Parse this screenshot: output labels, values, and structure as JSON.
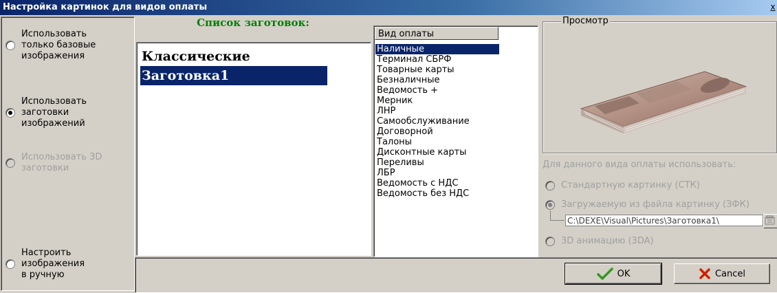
{
  "window": {
    "title": "Настройка картинок для видов оплаты",
    "close_label": "x"
  },
  "left_options": [
    {
      "label": "Использовать только базовые изображения",
      "checked": false,
      "disabled": false
    },
    {
      "label": "Использовать заготовки изображений",
      "checked": true,
      "disabled": false
    },
    {
      "label": "Использовать 3D заготовки",
      "checked": false,
      "disabled": true
    },
    {
      "label": "Настроить изображения в ручную",
      "checked": false,
      "disabled": false
    }
  ],
  "presets": {
    "header": "Список заготовок:",
    "items": [
      "Классические",
      "Заготовка1"
    ],
    "selected_index": 1
  },
  "payment_types": {
    "column_header": "Вид оплаты",
    "items": [
      "Наличные",
      "Терминал СБРФ",
      "Товарные карты",
      "Безналичные",
      "Ведомость +",
      "Мерник",
      "ЛНР",
      "Самообслуживание",
      "Договорной",
      "Талоны",
      "Дисконтные карты",
      "Переливы",
      "ЛБР",
      "Ведомость с НДС",
      "Ведомость без НДС"
    ],
    "selected_index": 0
  },
  "preview": {
    "legend": "Просмотр",
    "image": "banknote-stack-image"
  },
  "use_settings": {
    "caption": "Для данного вида оплаты использовать:",
    "options": [
      {
        "label": "Стандартную картинку (СТК)",
        "checked": false
      },
      {
        "label": "Загружаемую из файла картинку (ЗФК)",
        "checked": true
      },
      {
        "label": "3D анимацию (3DA)",
        "checked": false
      }
    ],
    "file_path": "C:\\DEXE\\Visual\\Pictures\\Заготовка1\\"
  },
  "buttons": {
    "ok": "OK",
    "cancel": "Cancel"
  },
  "colors": {
    "title_bar": "#0a246a",
    "selection": "#0a246a",
    "list_header": "#008000",
    "ok_icon": "#2e9b1c",
    "cancel_icon": "#cc2200"
  }
}
